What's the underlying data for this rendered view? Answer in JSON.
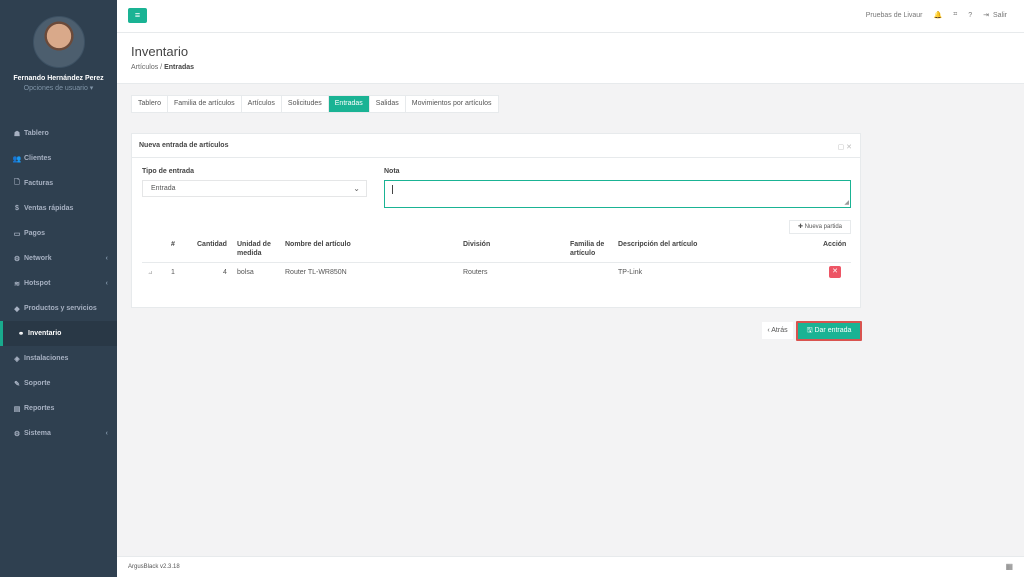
{
  "user": {
    "name": "Fernando Hernández Perez",
    "options": "Opciones de usuario ▾"
  },
  "nav": [
    {
      "icon": "☗",
      "label": "Tablero"
    },
    {
      "icon": "👥",
      "label": "Clientes"
    },
    {
      "icon": "🗋",
      "label": "Facturas"
    },
    {
      "icon": "$",
      "label": "Ventas rápidas"
    },
    {
      "icon": "▭",
      "label": "Pagos"
    },
    {
      "icon": "⚙",
      "label": "Network",
      "chev": "‹"
    },
    {
      "icon": "≋",
      "label": "Hotspot",
      "chev": "‹"
    },
    {
      "icon": "◆",
      "label": "Productos y servicios"
    },
    {
      "icon": "⚭",
      "label": "Inventario",
      "active": true
    },
    {
      "icon": "◈",
      "label": "Instalaciones"
    },
    {
      "icon": "✎",
      "label": "Soporte"
    },
    {
      "icon": "▤",
      "label": "Reportes"
    },
    {
      "icon": "⚙",
      "label": "Sistema",
      "chev": "‹"
    }
  ],
  "topbar": {
    "menu_icon": "≡",
    "company": "Pruebas de Livaur",
    "bell": "🔔",
    "grid": "⌗",
    "help": "?",
    "logout_icon": "⇥",
    "logout": "Salir"
  },
  "page": {
    "title": "Inventario",
    "crumb1": "Artículos /",
    "crumb2": "Entradas"
  },
  "tabs": [
    "Tablero",
    "Familia de artículos",
    "Artículos",
    "Solicitudes",
    "Entradas",
    "Salidas",
    "Movimientos por artículos"
  ],
  "active_tab": "Entradas",
  "panel": {
    "title": "Nueva entrada de artículos",
    "tools": "▢ ✕"
  },
  "form": {
    "tipo_label": "Tipo de entrada",
    "tipo_value": "Entrada",
    "caret": "⌄",
    "nota_label": "Nota",
    "nota_value": "",
    "add_label": "✚ Nueva partida"
  },
  "table": {
    "headers": {
      "num": "#",
      "cantidad": "Cantidad",
      "unidad": "Unidad de medida",
      "nombre": "Nombre del artículo",
      "division": "División",
      "familia": "Familia de artículo",
      "descripcion": "Descripción del artículo",
      "accion": "Acción"
    },
    "row": {
      "num": "1",
      "cantidad": "4",
      "unidad": "bolsa",
      "nombre": "Router TL-WR850N",
      "division": "Routers",
      "familia": "",
      "descripcion": "TP-Link",
      "delete": "✕"
    }
  },
  "buttons": {
    "back": "‹ Atrás",
    "submit": "🖫 Dar entrada"
  },
  "footer": {
    "version": "ArgusBlack v2.3.18",
    "icon": "▦"
  },
  "colors": {
    "accent": "#1ab394",
    "sidebar": "#2f4050",
    "danger": "#ed5565",
    "highlight_border": "#d9534f"
  }
}
